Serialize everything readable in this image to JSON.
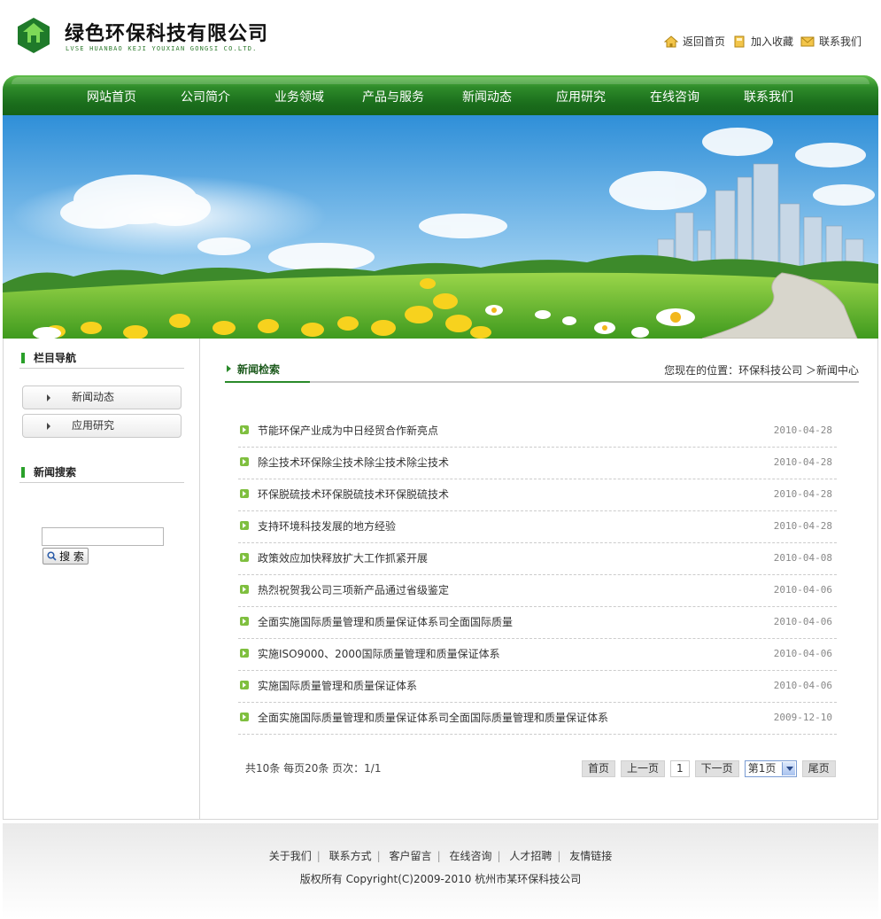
{
  "brand": {
    "title": "绿色环保科技有限公司",
    "subtitle": "LVSE HUANBAO KEJI YOUXIAN GONGSI CO.LTD."
  },
  "top_links": [
    {
      "label": "返回首页",
      "icon": "home-icon"
    },
    {
      "label": "加入收藏",
      "icon": "favorite-icon"
    },
    {
      "label": "联系我们",
      "icon": "mail-icon"
    }
  ],
  "nav": [
    "网站首页",
    "公司简介",
    "业务领域",
    "产品与服务",
    "新闻动态",
    "应用研究",
    "在线咨询",
    "联系我们"
  ],
  "sidebar": {
    "section_title": "栏目导航",
    "items": [
      "新闻动态",
      "应用研究"
    ],
    "search_title": "新闻搜索",
    "search_button": "搜 索",
    "search_value": ""
  },
  "main": {
    "title": "新闻检索",
    "breadcrumb": "您现在的位置：环保科技公司 ＞新闻中心",
    "news": [
      {
        "title": "节能环保产业成为中日经贸合作新亮点",
        "date": "2010-04-28"
      },
      {
        "title": "除尘技术环保除尘技术除尘技术除尘技术",
        "date": "2010-04-28"
      },
      {
        "title": "环保脱硫技术环保脱硫技术环保脱硫技术",
        "date": "2010-04-28"
      },
      {
        "title": "支持环境科技发展的地方经验",
        "date": "2010-04-28"
      },
      {
        "title": "政策效应加快释放扩大工作抓紧开展",
        "date": "2010-04-08"
      },
      {
        "title": "热烈祝贺我公司三项新产品通过省级鉴定",
        "date": "2010-04-06"
      },
      {
        "title": "全面实施国际质量管理和质量保证体系司全面国际质量",
        "date": "2010-04-06"
      },
      {
        "title": "实施ISO9000、2000国际质量管理和质量保证体系",
        "date": "2010-04-06"
      },
      {
        "title": "实施国际质量管理和质量保证体系",
        "date": "2010-04-06"
      },
      {
        "title": "全面实施国际质量管理和质量保证体系司全面国际质量管理和质量保证体系",
        "date": "2009-12-10"
      }
    ],
    "pager_info": "共10条 每页20条 页次：1/1",
    "pager": {
      "first": "首页",
      "prev": "上一页",
      "current": "1",
      "next": "下一页",
      "select_value": "第1页",
      "last": "尾页"
    }
  },
  "footer": {
    "links": [
      "关于我们",
      "联系方式",
      "客户留言",
      "在线咨询",
      "人才招聘",
      "友情链接"
    ],
    "copyright": "版权所有  Copyright(C)2009-2010 杭州市某环保科技公司"
  },
  "colors": {
    "brand_green": "#2e8b2a",
    "nav_dark": "#166218",
    "accent_light_green": "#7fbf3f"
  }
}
